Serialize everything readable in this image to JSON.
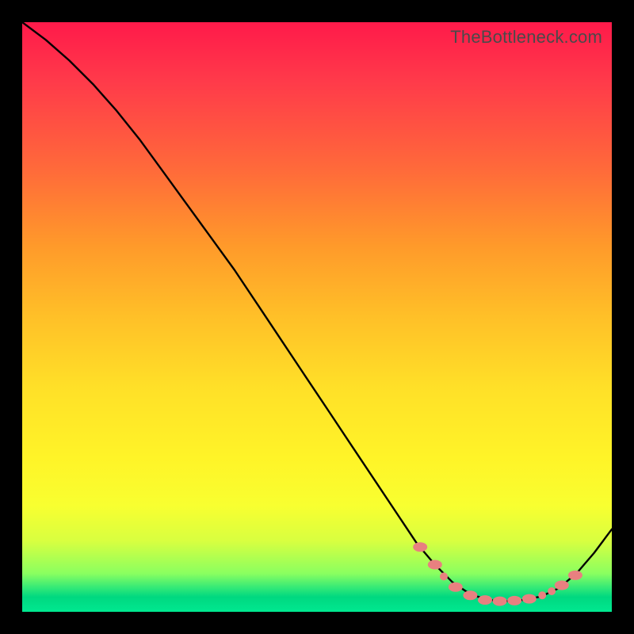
{
  "watermark": "TheBottleneck.com",
  "chart_data": {
    "type": "line",
    "title": "",
    "xlabel": "",
    "ylabel": "",
    "xlim": [
      0,
      100
    ],
    "ylim": [
      0,
      100
    ],
    "series": [
      {
        "name": "curve",
        "x": [
          0,
          4,
          8,
          12,
          16,
          20,
          24,
          28,
          32,
          36,
          40,
          44,
          48,
          52,
          56,
          60,
          64,
          67,
          70,
          73,
          76,
          79,
          82,
          85,
          88,
          91,
          94,
          97,
          100
        ],
        "y": [
          100,
          97,
          93.5,
          89.5,
          85,
          80,
          74.5,
          69,
          63.5,
          58,
          52,
          46,
          40,
          34,
          28,
          22,
          16,
          11.5,
          8,
          5,
          3,
          2,
          1.8,
          2,
          2.6,
          4,
          6.5,
          10,
          14
        ]
      }
    ],
    "markers": [
      {
        "x": 67.5,
        "y": 11.0,
        "shape": "ellipse"
      },
      {
        "x": 70.0,
        "y": 8.0,
        "shape": "ellipse"
      },
      {
        "x": 71.5,
        "y": 6.0,
        "shape": "dot"
      },
      {
        "x": 73.5,
        "y": 4.2,
        "shape": "ellipse"
      },
      {
        "x": 76.0,
        "y": 2.8,
        "shape": "ellipse"
      },
      {
        "x": 78.5,
        "y": 2.0,
        "shape": "ellipse"
      },
      {
        "x": 81.0,
        "y": 1.8,
        "shape": "ellipse"
      },
      {
        "x": 83.5,
        "y": 1.9,
        "shape": "ellipse"
      },
      {
        "x": 86.0,
        "y": 2.2,
        "shape": "ellipse"
      },
      {
        "x": 88.2,
        "y": 2.8,
        "shape": "dot"
      },
      {
        "x": 89.8,
        "y": 3.5,
        "shape": "dot"
      },
      {
        "x": 91.5,
        "y": 4.5,
        "shape": "ellipse"
      },
      {
        "x": 93.8,
        "y": 6.2,
        "shape": "ellipse"
      }
    ],
    "marker_color": "#e88080",
    "curve_color": "#000000"
  }
}
